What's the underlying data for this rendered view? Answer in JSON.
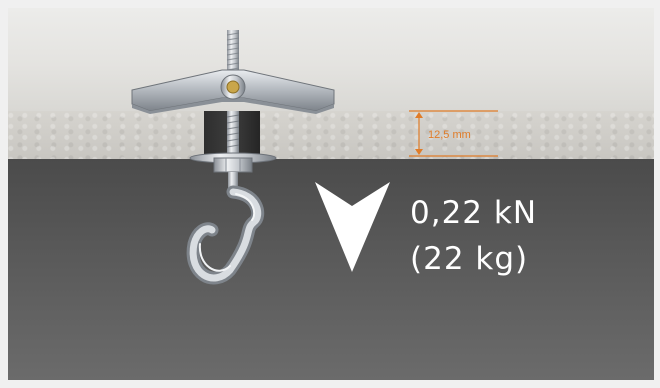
{
  "dimension": {
    "label": "12,5 mm",
    "color": "#e07c28"
  },
  "load": {
    "force": "0,22 kN",
    "mass": "(22 kg)",
    "arrow_icon": "down-arrow-icon"
  },
  "colors": {
    "ceiling": "#e6e5e2",
    "ceiling_edge": "#cfcdc8",
    "room": "#555555",
    "metal": "#b9bec4",
    "text": "#ffffff"
  }
}
